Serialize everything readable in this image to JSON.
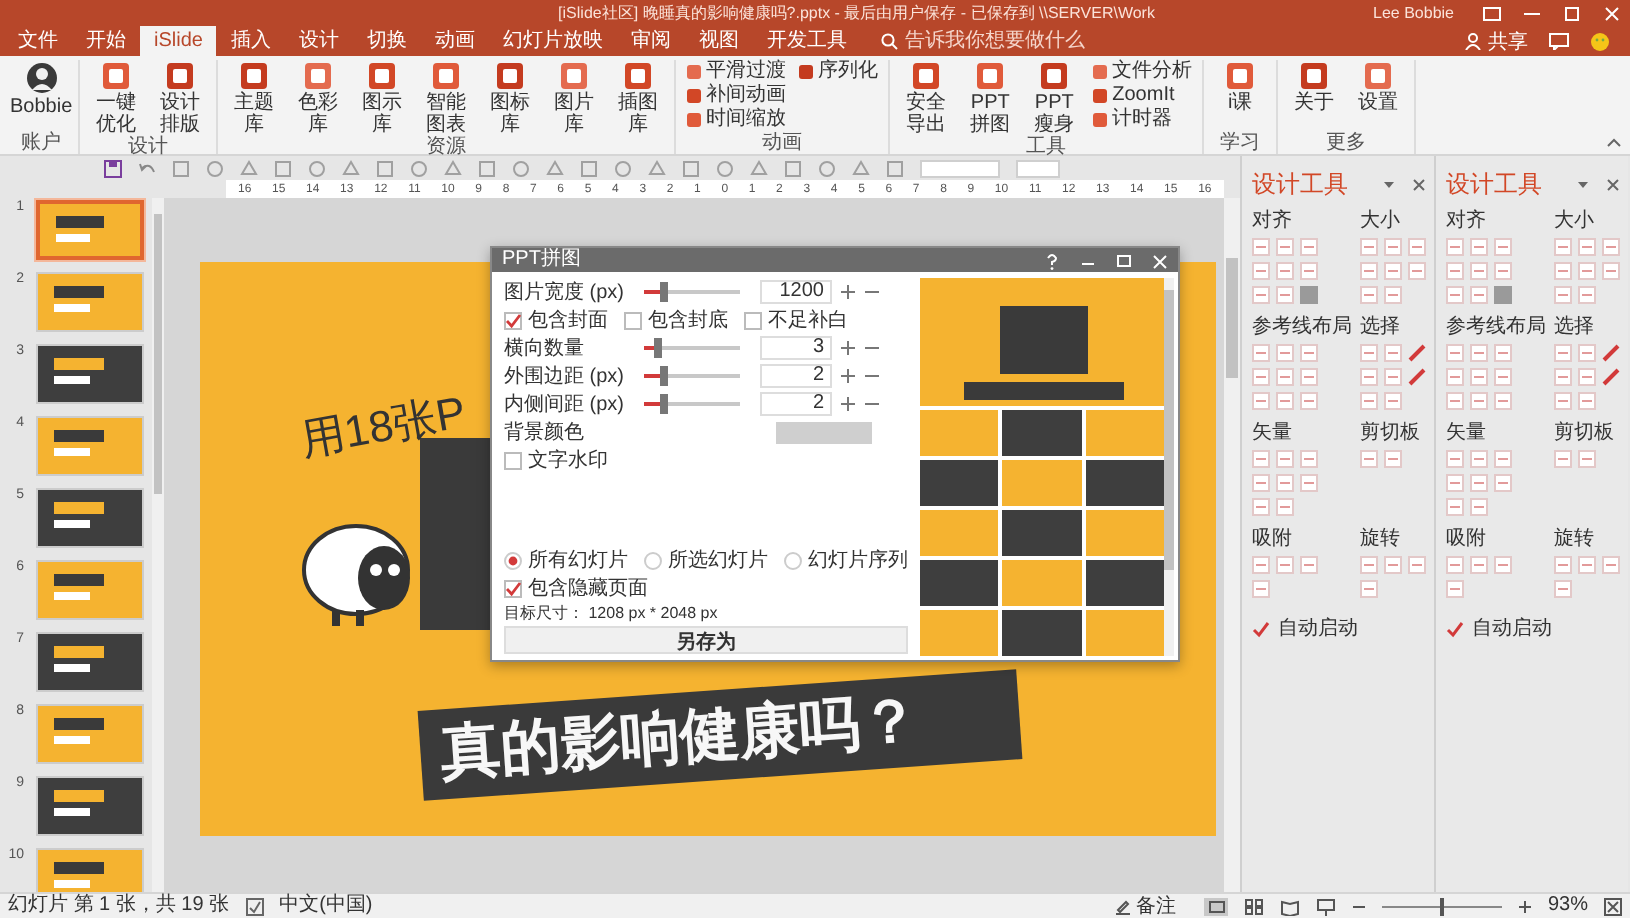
{
  "window": {
    "title": "[iSlide社区] 晚睡真的影响健康吗?.pptx - 最后由用户保存 - 已保存到 \\\\SERVER\\Work",
    "user": "Lee Bobbie"
  },
  "tabs": [
    {
      "label": "文件",
      "selected": false
    },
    {
      "label": "开始",
      "selected": false
    },
    {
      "label": "iSlide",
      "selected": true
    },
    {
      "label": "插入",
      "selected": false
    },
    {
      "label": "设计",
      "selected": false
    },
    {
      "label": "切换",
      "selected": false
    },
    {
      "label": "动画",
      "selected": false
    },
    {
      "label": "幻灯片放映",
      "selected": false
    },
    {
      "label": "审阅",
      "selected": false
    },
    {
      "label": "视图",
      "selected": false
    },
    {
      "label": "开发工具",
      "selected": false
    }
  ],
  "search": {
    "placeholder": "告诉我你想要做什么"
  },
  "share": {
    "label": "共享"
  },
  "ribbon": {
    "groups": [
      {
        "label": "账户",
        "buttons": [
          {
            "label": "Bobbie",
            "kind": "account"
          }
        ]
      },
      {
        "label": "设计",
        "buttons": [
          {
            "label": "一键优化",
            "kind": "large"
          },
          {
            "label": "设计排版",
            "kind": "large"
          }
        ]
      },
      {
        "label": "资源",
        "buttons": [
          {
            "label": "主题库",
            "kind": "large"
          },
          {
            "label": "色彩库",
            "kind": "large"
          },
          {
            "label": "图示库",
            "kind": "large"
          },
          {
            "label": "智能图表",
            "kind": "large"
          },
          {
            "label": "图标库",
            "kind": "large"
          },
          {
            "label": "图片库",
            "kind": "large"
          },
          {
            "label": "插图库",
            "kind": "large"
          }
        ]
      },
      {
        "label": "动画",
        "buttons": [
          {
            "label": "平滑过渡",
            "kind": "small"
          },
          {
            "label": "补间动画",
            "kind": "small"
          },
          {
            "label": "时间缩放",
            "kind": "small"
          },
          {
            "label": "序列化",
            "kind": "small"
          }
        ]
      },
      {
        "label": "工具",
        "buttons": [
          {
            "label": "安全导出",
            "kind": "large"
          },
          {
            "label": "PPT拼图",
            "kind": "large"
          },
          {
            "label": "PPT瘦身",
            "kind": "large"
          },
          {
            "label": "文件分析",
            "kind": "small"
          },
          {
            "label": "ZoomIt",
            "kind": "small"
          },
          {
            "label": "计时器",
            "kind": "small"
          }
        ]
      },
      {
        "label": "学习",
        "buttons": [
          {
            "label": "i课",
            "kind": "large"
          }
        ]
      },
      {
        "label": "更多",
        "buttons": [
          {
            "label": "关于",
            "kind": "large"
          },
          {
            "label": "设置",
            "kind": "large"
          }
        ]
      }
    ]
  },
  "ruler": {
    "ticks": [
      "16",
      "15",
      "14",
      "13",
      "12",
      "11",
      "10",
      "9",
      "8",
      "7",
      "6",
      "5",
      "4",
      "3",
      "2",
      "1",
      "0",
      "1",
      "2",
      "3",
      "4",
      "5",
      "6",
      "7",
      "8",
      "9",
      "10",
      "11",
      "12",
      "13",
      "14",
      "15",
      "16"
    ]
  },
  "thumbnails": [
    {
      "number": "1",
      "selected": true,
      "kind": "light"
    },
    {
      "number": "2",
      "selected": false,
      "kind": "light"
    },
    {
      "number": "3",
      "selected": false,
      "kind": "dark"
    },
    {
      "number": "4",
      "selected": false,
      "kind": "light"
    },
    {
      "number": "5",
      "selected": false,
      "kind": "dark"
    },
    {
      "number": "6",
      "selected": false,
      "kind": "light"
    },
    {
      "number": "7",
      "selected": false,
      "kind": "dark"
    },
    {
      "number": "8",
      "selected": false,
      "kind": "light"
    },
    {
      "number": "9",
      "selected": false,
      "kind": "dark"
    },
    {
      "number": "10",
      "selected": false,
      "kind": "light"
    }
  ],
  "slide": {
    "title_fragment": "用18张P",
    "banner": "真的影响健康吗？"
  },
  "dialog": {
    "title": "PPT拼图",
    "rows": [
      {
        "kind": "slider",
        "label": "图片宽度 (px)",
        "level": 0.2,
        "value": "1200"
      },
      {
        "kind": "checks",
        "options": [
          {
            "label": "包含封面",
            "checked": true
          },
          {
            "label": "包含封底",
            "checked": false
          },
          {
            "label": "不足补白",
            "checked": false
          }
        ]
      },
      {
        "kind": "slider",
        "label": "横向数量",
        "level": 0.15,
        "value": "3"
      },
      {
        "kind": "slider",
        "label": "外围边距 (px)",
        "level": 0.2,
        "value": "2"
      },
      {
        "kind": "slider",
        "label": "内侧间距 (px)",
        "level": 0.2,
        "value": "2"
      },
      {
        "kind": "color",
        "label": "背景颜色"
      },
      {
        "kind": "checks",
        "options": [
          {
            "label": "文字水印",
            "checked": false
          }
        ]
      }
    ],
    "scope": [
      {
        "label": "所有幻灯片",
        "selected": true
      },
      {
        "label": "所选幻灯片",
        "selected": false
      },
      {
        "label": "幻灯片序列",
        "selected": false
      }
    ],
    "include_hidden": {
      "label": "包含隐藏页面",
      "checked": true
    },
    "target_size": "目标尺寸： 1208 px * 2048 px",
    "save_button": "另存为"
  },
  "panels": [
    {
      "title": "设计工具",
      "sections": [
        {
          "label": "对齐"
        },
        {
          "label": "大小"
        },
        {
          "label": "参考线布局"
        },
        {
          "label": "选择"
        },
        {
          "label": "矢量"
        },
        {
          "label": "剪切板"
        },
        {
          "label": "吸附"
        },
        {
          "label": "旋转"
        }
      ],
      "auto_start": {
        "label": "自动启动",
        "checked": true
      }
    },
    {
      "title": "设计工具",
      "sections": [
        {
          "label": "对齐"
        },
        {
          "label": "大小"
        },
        {
          "label": "参考线布局"
        },
        {
          "label": "选择"
        },
        {
          "label": "矢量"
        },
        {
          "label": "剪切板"
        },
        {
          "label": "吸附"
        },
        {
          "label": "旋转"
        }
      ],
      "auto_start": {
        "label": "自动启动",
        "checked": true
      }
    }
  ],
  "status_bar": {
    "slide_info": "幻灯片 第 1 张，共 19 张",
    "language": "中文(中国)",
    "notes": "备注",
    "zoom_slider": {
      "level": 0.5
    },
    "zoom": "93%"
  }
}
